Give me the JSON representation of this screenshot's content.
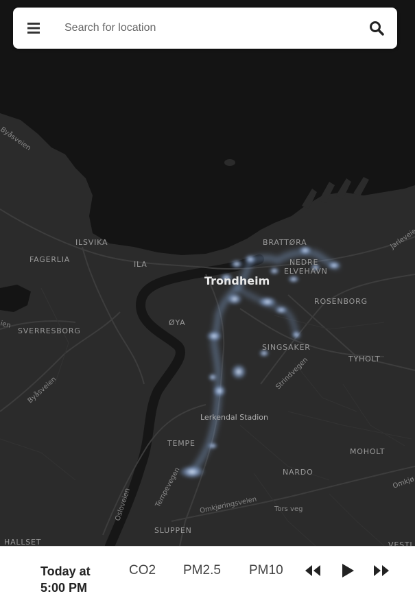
{
  "search": {
    "placeholder": "Search for location"
  },
  "icons": {
    "menu": "menu-icon",
    "search": "search-icon",
    "rewind": "rewind-icon",
    "play": "play-icon",
    "fast_forward": "fast-forward-icon"
  },
  "map": {
    "city": "Trondheim",
    "districts": [
      "BRATTØRA",
      "NEDRE",
      "ELVEHAVN",
      "ILSVIKA",
      "FAGERLIA",
      "ILA",
      "ROSENBORG",
      "ØYA",
      "SVERRESBORG",
      "SINGSAKER",
      "TYHOLT",
      "TEMPE",
      "MOHOLT",
      "NARDO",
      "SLUPPEN",
      "HALLSET",
      "VESTLI"
    ],
    "roads": [
      "Byåsveien",
      "Byåsveien",
      "Jarleveien",
      "Strindvegen",
      "Tempevegen",
      "Osloveien",
      "Omkjøringsveien",
      "Tors veg",
      "Omkjø",
      "ien"
    ],
    "poi": [
      "Lerkendal Stadion"
    ],
    "colors": {
      "water": "#141414",
      "land": "#2c2c2c",
      "heat": "#9fc8ff"
    }
  },
  "bottom": {
    "time_line1": "Today at",
    "time_line2": "5:00 PM",
    "pollutants": [
      "CO2",
      "PM2.5",
      "PM10"
    ]
  }
}
